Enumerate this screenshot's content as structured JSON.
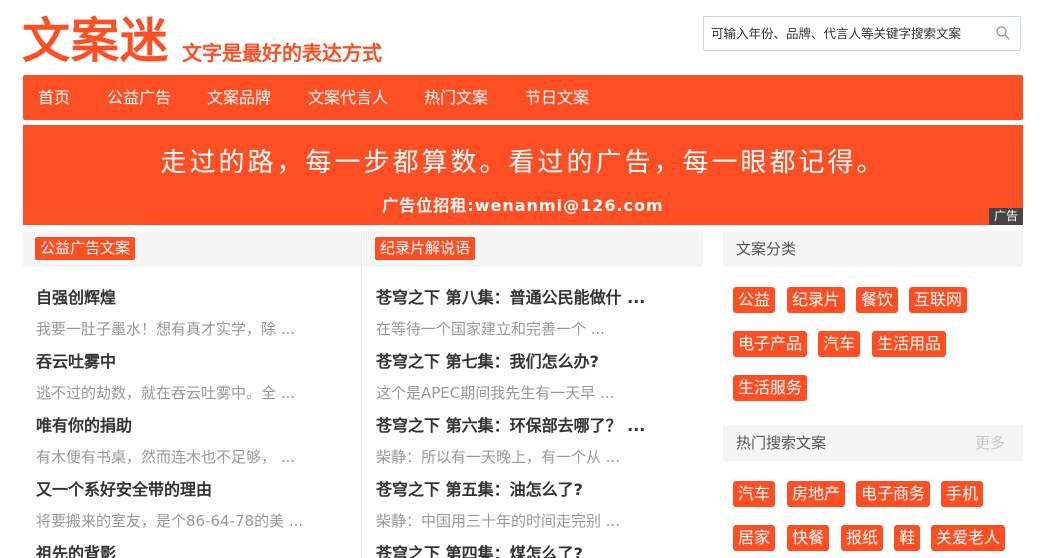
{
  "header": {
    "logo": "文案迷",
    "slogan": "文字是最好的表达方式",
    "search_placeholder": "可输入年份、品牌、代言人等关键字搜索文案"
  },
  "nav": {
    "items": [
      "首页",
      "公益广告",
      "文案品牌",
      "文案代言人",
      "热门文案",
      "节日文案"
    ]
  },
  "banner": {
    "line1": "走过的路，每一步都算数。看过的广告，每一眼都记得。",
    "line2": "广告位招租:wenanmi@126.com",
    "ad_tag": "广告"
  },
  "left_column": {
    "tag": "公益广告文案",
    "items": [
      {
        "title": "自强创辉煌",
        "desc": "我要一肚子墨水！想有真才实学，除 ..."
      },
      {
        "title": "吞云吐雾中",
        "desc": "逃不过的劫数，就在吞云吐雾中。全 ..."
      },
      {
        "title": "唯有你的捐助",
        "desc": "有木便有书桌，然而连木也不足够，  ..."
      },
      {
        "title": "又一个系好安全带的理由",
        "desc": "将要搬来的室友，是个86-64-78的美 ..."
      },
      {
        "title": "祖先的背影",
        "desc": ""
      }
    ]
  },
  "mid_column": {
    "tag": "纪录片解说语",
    "items": [
      {
        "title": "苍穹之下 第八集：普通公民能做什 ...",
        "desc": "在等待一个国家建立和完善一个 ..."
      },
      {
        "title": "苍穹之下 第七集：我们怎么办?",
        "desc": "这个是APEC期间我先生有一天早 ..."
      },
      {
        "title": "苍穹之下 第六集：环保部去哪了？ ...",
        "desc": "柴静：所以有一天晚上，有一个从 ..."
      },
      {
        "title": "苍穹之下 第五集：油怎么了?",
        "desc": "柴静：中国用三十年的时间走完别 ..."
      },
      {
        "title": "苍穹之下 第四集：煤怎么了?",
        "desc": ""
      }
    ]
  },
  "sidebar": {
    "categories_title": "文案分类",
    "categories": [
      "公益",
      "纪录片",
      "餐饮",
      "互联网",
      "电子产品",
      "汽车",
      "生活用品",
      "生活服务"
    ],
    "hot_title": "热门搜索文案",
    "more_label": "更多",
    "hot_tags": [
      "汽车",
      "房地产",
      "电子商务",
      "手机",
      "居家",
      "快餐",
      "报纸",
      "鞋",
      "关爱老人"
    ]
  }
}
